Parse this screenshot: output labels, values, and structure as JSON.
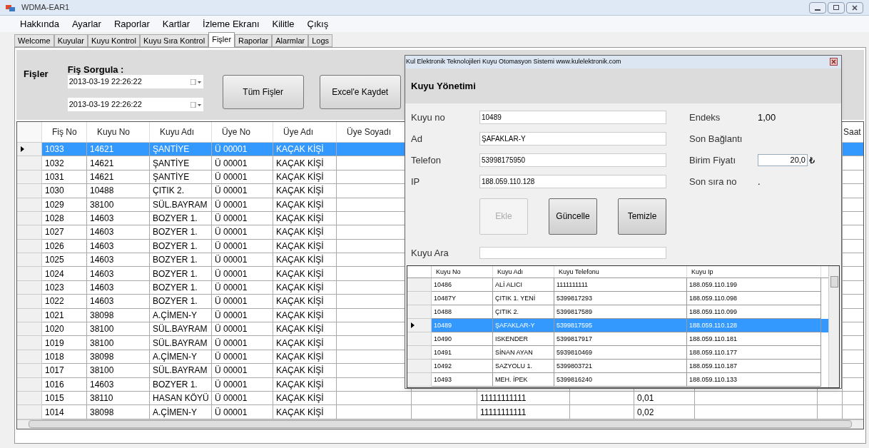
{
  "window": {
    "title": "WDMA-EAR1"
  },
  "menu": [
    "Hakkında",
    "Ayarlar",
    "Raporlar",
    "Kartlar",
    "İzleme Ekranı",
    "Kilitle",
    "Çıkış"
  ],
  "tabs": [
    {
      "label": "Welcome",
      "selected": false
    },
    {
      "label": "Kuyular",
      "selected": false
    },
    {
      "label": "Kuyu Kontrol",
      "selected": false
    },
    {
      "label": "Kuyu Sıra Kontrol",
      "selected": false
    },
    {
      "label": "Fişler",
      "selected": true
    },
    {
      "label": "Raporlar",
      "selected": false
    },
    {
      "label": "Alarmlar",
      "selected": false
    },
    {
      "label": "Logs",
      "selected": false
    }
  ],
  "panel": {
    "title": "Fişler",
    "query_label": "Fiş Sorgula :",
    "date_from": "2013-03-19 22:26:22",
    "date_to": "2013-03-19 22:26:22",
    "buttons": [
      "Tüm Fişler",
      "Excel'e Kaydet"
    ]
  },
  "table": {
    "columns": [
      "Fiş No",
      "Kuyu No",
      "Kuyu Adı",
      "Üye No",
      "Üye Adı",
      "Üye Soyadı"
    ],
    "last_column": "Saat",
    "rows": [
      {
        "cells": [
          "1033",
          "14621",
          "ŞANTİYE",
          "Ü  00001",
          "KAÇAK KİŞİ"
        ],
        "selected": true
      },
      {
        "cells": [
          "1032",
          "14621",
          "ŞANTİYE",
          "Ü  00001",
          "KAÇAK KİŞİ"
        ],
        "selected": false
      },
      {
        "cells": [
          "1031",
          "14621",
          "ŞANTİYE",
          "Ü  00001",
          "KAÇAK KİŞİ"
        ],
        "selected": false
      },
      {
        "cells": [
          "1030",
          "10488",
          "ÇITIK 2.",
          "Ü  00001",
          "KAÇAK KİŞİ"
        ],
        "selected": false
      },
      {
        "cells": [
          "1029",
          "38100",
          "SÜL.BAYRAM",
          "Ü  00001",
          "KAÇAK KİŞİ"
        ],
        "selected": false
      },
      {
        "cells": [
          "1028",
          "14603",
          "BOZYER 1.",
          "Ü  00001",
          "KAÇAK KİŞİ"
        ],
        "selected": false
      },
      {
        "cells": [
          "1027",
          "14603",
          "BOZYER 1.",
          "Ü  00001",
          "KAÇAK KİŞİ"
        ],
        "selected": false
      },
      {
        "cells": [
          "1026",
          "14603",
          "BOZYER 1.",
          "Ü  00001",
          "KAÇAK KİŞİ"
        ],
        "selected": false
      },
      {
        "cells": [
          "1025",
          "14603",
          "BOZYER 1.",
          "Ü  00001",
          "KAÇAK KİŞİ"
        ],
        "selected": false
      },
      {
        "cells": [
          "1024",
          "14603",
          "BOZYER 1.",
          "Ü  00001",
          "KAÇAK KİŞİ"
        ],
        "selected": false
      },
      {
        "cells": [
          "1023",
          "14603",
          "BOZYER 1.",
          "Ü  00001",
          "KAÇAK KİŞİ"
        ],
        "selected": false
      },
      {
        "cells": [
          "1022",
          "14603",
          "BOZYER 1.",
          "Ü  00001",
          "KAÇAK KİŞİ"
        ],
        "selected": false
      },
      {
        "cells": [
          "1021",
          "38098",
          "A.ÇİMEN-Y",
          "Ü  00001",
          "KAÇAK KİŞİ"
        ],
        "selected": false
      },
      {
        "cells": [
          "1020",
          "38100",
          "SÜL.BAYRAM",
          "Ü  00001",
          "KAÇAK KİŞİ"
        ],
        "selected": false
      },
      {
        "cells": [
          "1019",
          "38100",
          "SÜL.BAYRAM",
          "Ü  00001",
          "KAÇAK KİŞİ"
        ],
        "selected": false
      },
      {
        "cells": [
          "1018",
          "38098",
          "A.ÇİMEN-Y",
          "Ü  00001",
          "KAÇAK KİŞİ"
        ],
        "selected": false
      },
      {
        "cells": [
          "1017",
          "38100",
          "SÜL.BAYRAM",
          "Ü  00001",
          "KAÇAK KİŞİ"
        ],
        "selected": false
      },
      {
        "cells": [
          "1016",
          "14603",
          "BOZYER 1.",
          "Ü  00001",
          "KAÇAK KİŞİ"
        ],
        "selected": false
      },
      {
        "cells": [
          "1015",
          "38110",
          "HASAN KÖYÜ",
          "Ü  00001",
          "KAÇAK KİŞİ"
        ],
        "selected": false,
        "column_8": "11111111111",
        "column_10": "0,01"
      },
      {
        "cells": [
          "1014",
          "38098",
          "A.ÇİMEN-Y",
          "Ü  00001",
          "KAÇAK KİŞİ"
        ],
        "selected": false,
        "column_8": "11111111111",
        "column_10": "0,02"
      }
    ]
  },
  "dialog": {
    "title": "Kul Elektronik Teknolojileri  Kuyu Otomasyon Sistemi www.kulelektronik.com",
    "heading": "Kuyu Yönetimi",
    "fields": [
      {
        "label": "Kuyu no",
        "value": "10489"
      },
      {
        "label": "Ad",
        "value": "ŞAFAKLAR-Y"
      },
      {
        "label": "Telefon",
        "value": "53998175950"
      },
      {
        "label": "IP",
        "value": "188.059.110.128"
      }
    ],
    "info": [
      {
        "kind": "text",
        "label": "Endeks",
        "value": "1,00"
      },
      {
        "kind": "text",
        "label": "Son Bağlantı"
      },
      {
        "kind": "input",
        "label": "Birim Fiyatı",
        "value": "20,0",
        "unit": "₺"
      },
      {
        "kind": "text",
        "label": "Son sıra no",
        "value": "."
      }
    ],
    "buttons": [
      {
        "label": "Ekle",
        "disabled": true
      },
      {
        "label": "Güncelle",
        "disabled": false
      },
      {
        "label": "Temizle",
        "disabled": false
      }
    ],
    "search_label": "Kuyu Ara",
    "grid": {
      "columns": [
        "Kuyu No",
        "Kuyu Adı",
        "Kuyu Telefonu",
        "Kuyu Ip"
      ],
      "rows": [
        {
          "cells": [
            "10486",
            "ALİ ALICI",
            "1111111111",
            "188.059.110.199"
          ],
          "selected": false
        },
        {
          "cells": [
            "10487Y",
            "ÇITIK 1. YENİ",
            "5399817293",
            "188.059.110.098"
          ],
          "selected": false
        },
        {
          "cells": [
            "10488",
            "ÇITIK 2.",
            "5399817589",
            "188.059.110.099"
          ],
          "selected": false
        },
        {
          "cells": [
            "10489",
            "ŞAFAKLAR-Y",
            "5399817595",
            "188.059.110.128"
          ],
          "selected": true
        },
        {
          "cells": [
            "10490",
            "ISKENDER",
            "5399817917",
            "188.059.110.181"
          ],
          "selected": false
        },
        {
          "cells": [
            "10491",
            "SİNAN AYAN",
            "5939810469",
            "188.059.110.177"
          ],
          "selected": false
        },
        {
          "cells": [
            "10492",
            "SAZYOLU 1.",
            "5399803721",
            "188.059.110.187"
          ],
          "selected": false
        },
        {
          "cells": [
            "10493",
            "MEH. İPEK",
            "5399816240",
            "188.059.110.133"
          ],
          "selected": false
        }
      ]
    }
  }
}
